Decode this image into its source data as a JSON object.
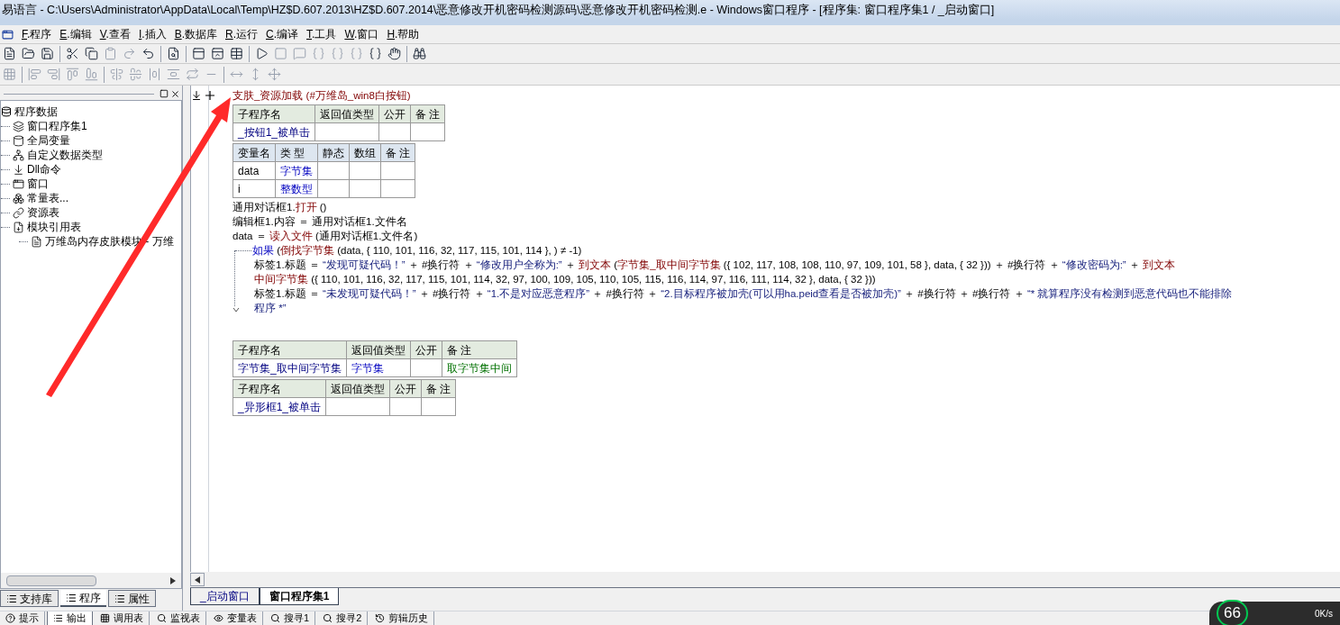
{
  "window": {
    "title": "易语言 - C:\\Users\\Administrator\\AppData\\Local\\Temp\\HZ$D.607.2013\\HZ$D.607.2014\\恶意修改开机密码检测源码\\恶意修改开机密码检测.e - Windows窗口程序 - [程序集: 窗口程序集1 / _启动窗口]"
  },
  "menu": [
    "F.程序",
    "E.编辑",
    "V.查看",
    "I.插入",
    "B.数据库",
    "R.运行",
    "C.编译",
    "T.工具",
    "W.窗口",
    "H.帮助"
  ],
  "tree": {
    "label": "程序数据",
    "children": [
      {
        "label": "窗口程序集1",
        "kind": "class"
      },
      {
        "label": "全局变量",
        "kind": "global"
      },
      {
        "label": "自定义数据类型",
        "kind": "type"
      },
      {
        "label": "Dll命令",
        "kind": "dll"
      },
      {
        "label": "窗口",
        "kind": "window"
      },
      {
        "label": "常量表...",
        "kind": "const"
      },
      {
        "label": "资源表",
        "kind": "resource"
      },
      {
        "label": "模块引用表",
        "kind": "module",
        "children": [
          {
            "label": "万维岛内存皮肤模块 - 万维",
            "kind": "file"
          }
        ]
      }
    ]
  },
  "left_tabs": [
    {
      "label": "支持库",
      "selected": false
    },
    {
      "label": "程序",
      "selected": true
    },
    {
      "label": "属性",
      "selected": false
    }
  ],
  "code": {
    "header": [
      {
        "text": "支肤_资源加载",
        "kind": "func"
      },
      {
        "text": " (#万维岛_win8白按钮)",
        "kind": "func"
      }
    ],
    "blocks": [
      {
        "kind": "sub_table",
        "columns": [
          "子程序名",
          "返回值类型",
          "公开",
          "备 注"
        ],
        "rows": [
          [
            {
              "text": "_按钮1_被单击",
              "kind": "name"
            },
            {
              "text": "",
              "kind": "type"
            },
            {
              "text": "",
              "kind": "plain"
            },
            {
              "text": "",
              "kind": "note"
            }
          ]
        ]
      },
      {
        "kind": "var_table",
        "columns": [
          "变量名",
          "类 型",
          "静态",
          "数组",
          "备 注"
        ],
        "rows": [
          [
            {
              "text": "data",
              "kind": "plain"
            },
            {
              "text": "字节集",
              "kind": "type"
            },
            {
              "text": "",
              "kind": "plain"
            },
            {
              "text": "",
              "kind": "plain"
            },
            {
              "text": "",
              "kind": "plain"
            }
          ],
          [
            {
              "text": "i",
              "kind": "plain"
            },
            {
              "text": "整数型",
              "kind": "type"
            },
            {
              "text": "",
              "kind": "plain"
            },
            {
              "text": "",
              "kind": "plain"
            },
            {
              "text": "",
              "kind": "plain"
            }
          ]
        ]
      },
      {
        "kind": "line",
        "segments": [
          {
            "text": "通用对话框1.",
            "kind": "plain"
          },
          {
            "text": "打开",
            "kind": "func"
          },
          {
            "text": " ()",
            "kind": "plain"
          }
        ]
      },
      {
        "kind": "line",
        "segments": [
          {
            "text": "编辑框1.内容 ＝ 通用对话框1.文件名",
            "kind": "plain"
          }
        ]
      },
      {
        "kind": "line",
        "segments": [
          {
            "text": "data ＝ ",
            "kind": "plain"
          },
          {
            "text": "读入文件",
            "kind": "func"
          },
          {
            "text": " (通用对话框1.文件名)",
            "kind": "plain"
          }
        ]
      },
      {
        "kind": "if",
        "segments": [
          {
            "text": "如果",
            "kind": "kw"
          },
          {
            "text": " (",
            "kind": "plain"
          },
          {
            "text": "倒找字节集",
            "kind": "func"
          },
          {
            "text": " (data, { 110, 101, 116, 32, 117, 115, 101, 114 }, ) ≠ -1)",
            "kind": "plain"
          }
        ],
        "children": [
          {
            "kind": "line",
            "segments": [
              {
                "text": "标签1.标题 ＝ ",
                "kind": "plain"
              },
              {
                "text": "“发现可疑代码！”",
                "kind": "str"
              },
              {
                "text": " ＋ #换行符 ＋ ",
                "kind": "plain"
              },
              {
                "text": "“修改用户全称为:”",
                "kind": "str"
              },
              {
                "text": " ＋ ",
                "kind": "plain"
              },
              {
                "text": "到文本",
                "kind": "func"
              },
              {
                "text": " (",
                "kind": "plain"
              },
              {
                "text": "字节集_取中间字节集",
                "kind": "func"
              },
              {
                "text": " ({ 102, 117, 108, 108, 110, 97, 109, 101, 58 }, data, { 32 })) ＋ #换行符 ＋ ",
                "kind": "plain"
              },
              {
                "text": "“修改密码为:”",
                "kind": "str"
              },
              {
                "text": " ＋ ",
                "kind": "plain"
              },
              {
                "text": "到文本",
                "kind": "func"
              }
            ]
          },
          {
            "kind": "line",
            "segments": [
              {
                "text": "中间字节集",
                "kind": "func"
              },
              {
                "text": " ({ 110, 101, 116, 32, 117, 115, 101, 114, 32, 97, 100, 109, 105, 110, 105, 115, 116, 114, 97, 116, 111, 114, 32 }, data, { 32 }))",
                "kind": "plain"
              }
            ]
          },
          {
            "kind": "line",
            "segments": [
              {
                "text": "标签1.标题 ＝ ",
                "kind": "plain"
              },
              {
                "text": "“未发现可疑代码！”",
                "kind": "str"
              },
              {
                "text": " ＋ #换行符 ＋ ",
                "kind": "plain"
              },
              {
                "text": "“1.不是对应恶意程序”",
                "kind": "str"
              },
              {
                "text": " ＋ #换行符 ＋ ",
                "kind": "plain"
              },
              {
                "text": "“2.目标程序被加壳(可以用ha.peid查看是否被加壳)”",
                "kind": "str"
              },
              {
                "text": " ＋ #换行符 ＋ #换行符 ＋ ",
                "kind": "plain"
              },
              {
                "text": "“* 就算程序没有检测到恶意代码也不能排除",
                "kind": "str"
              }
            ]
          },
          {
            "kind": "line",
            "segments": [
              {
                "text": "程序 *”",
                "kind": "str"
              }
            ]
          }
        ]
      },
      {
        "kind": "gap"
      },
      {
        "kind": "sub_table",
        "columns": [
          "子程序名",
          "返回值类型",
          "公开",
          "备 注"
        ],
        "rows": [
          [
            {
              "text": "字节集_取中间字节集",
              "kind": "name"
            },
            {
              "text": "字节集",
              "kind": "type"
            },
            {
              "text": "",
              "kind": "plain"
            },
            {
              "text": "取字节集中间",
              "kind": "note"
            }
          ]
        ]
      },
      {
        "kind": "sub_table",
        "columns": [
          "子程序名",
          "返回值类型",
          "公开",
          "备 注"
        ],
        "rows": [
          [
            {
              "text": "_异形框1_被单击",
              "kind": "name"
            },
            {
              "text": "",
              "kind": "type"
            },
            {
              "text": "",
              "kind": "plain"
            },
            {
              "text": "",
              "kind": "note"
            }
          ]
        ]
      }
    ]
  },
  "editor_tabs": [
    {
      "label": "_启动窗口",
      "selected": false
    },
    {
      "label": "窗口程序集1",
      "selected": true
    }
  ],
  "output_tabs": [
    {
      "label": "提示",
      "selected": false
    },
    {
      "label": "输出",
      "selected": true
    },
    {
      "label": "调用表",
      "selected": false
    },
    {
      "label": "监视表",
      "selected": false
    },
    {
      "label": "变量表",
      "selected": false
    },
    {
      "label": "搜寻1",
      "selected": false
    },
    {
      "label": "搜寻2",
      "selected": false
    },
    {
      "label": "剪辑历史",
      "selected": false
    }
  ],
  "meter": {
    "value": "66",
    "speed": "0K/s"
  }
}
